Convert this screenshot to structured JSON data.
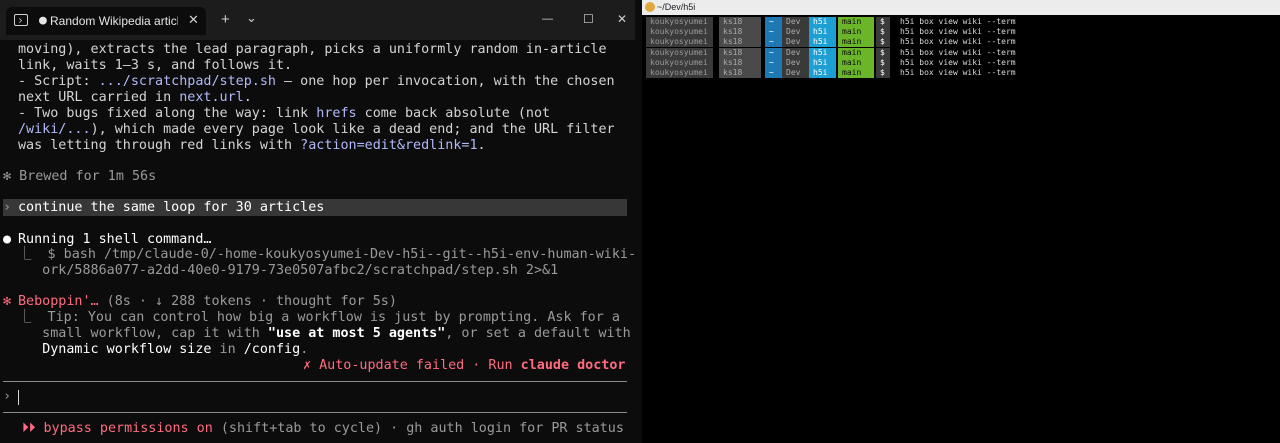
{
  "left_window": {
    "tab": {
      "title": "Random Wikipedia article e",
      "activity_dot": "●",
      "close": "✕"
    },
    "titlebar": {
      "new_tab": "+",
      "dropdown": "⌄",
      "minimize": "—",
      "maximize": "☐",
      "close": "✕"
    },
    "lines": {
      "l1": "moving), extracts the lead paragraph, picks a uniformly random in-article",
      "l2": "link, waits 1–3 s, and follows it.",
      "l3a": "- Script: ",
      "l3b": ".../scratchpad/step.sh",
      "l3c": " — one hop per invocation, with the chosen",
      "l4a": "next URL carried in ",
      "l4b": "next.url",
      "l4c": ".",
      "l5a": "- Two bugs fixed along the way: link ",
      "l5b": "hrefs",
      "l5c": " come back absolute (not",
      "l6a": "/wiki/...",
      "l6b": "), which made every page look like a dead end; and the URL filter",
      "l7a": "was letting through red links with ",
      "l7b": "?action=edit&redlink=1",
      "l7c": ".",
      "brewed": "✻ Brewed for 1m 56s",
      "prompt_marker": "›",
      "prompt_text": "continue the same loop for 30 articles",
      "running_bullet": "●",
      "running": "Running 1 shell command…",
      "cmd1": "⎿  $ bash /tmp/claude-0/-home-koukyosyumei-Dev-h5i--git--h5i-env-human-wiki-w",
      "cmd2": "   ork/5886a077-a2dd-40e0-9179-73e0507afbc2/scratchpad/step.sh 2>&1",
      "status_star": "✻",
      "status_word": "Beboppin'…",
      "status_detail": " (8s · ↓ 288 tokens · thought for 5s)",
      "tip1": "⎿  Tip: You can control how big a workflow is just by prompting. Ask for a",
      "tip2a": "   small workflow, cap it with ",
      "tip2b": "\"use at most 5 agents\"",
      "tip2c": ", or set a default with",
      "tip3a": "   ",
      "tip3b": "Dynamic workflow size",
      "tip3c": " in ",
      "tip3d": "/config",
      "tip3e": ".",
      "update_a": "✗ Auto-update failed · Run ",
      "update_b": "claude doctor",
      "input_prompt": "›",
      "footer_a": "⏵⏵ bypass permissions on",
      "footer_b": " (shift+tab to cycle) · gh auth login for PR status"
    }
  },
  "right_window": {
    "title": "~/Dev/h5i",
    "prompt": {
      "user": "koukyosyumei",
      "host": "ks18",
      "home": "~",
      "dev": "Dev",
      "repo": "h5i",
      "branch": "main",
      "symbol": "$"
    },
    "command": "h5i box view wiki --term",
    "row_count": 6
  }
}
